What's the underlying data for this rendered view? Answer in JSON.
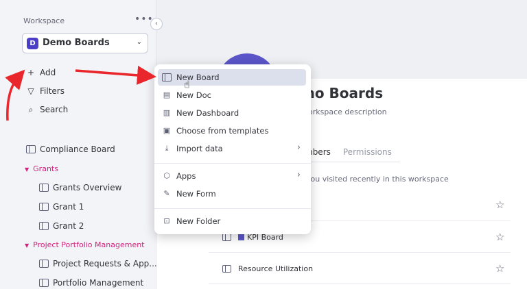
{
  "sidebar": {
    "header": "Workspace",
    "more": "•••",
    "workspace_badge": "D",
    "workspace_name": "Demo Boards",
    "actions": [
      {
        "label": "Add",
        "icon": "plus-icon"
      },
      {
        "label": "Filters",
        "icon": "filter-icon"
      },
      {
        "label": "Search",
        "icon": "search-icon"
      }
    ],
    "tree": {
      "compliance": "Compliance Board",
      "grants_folder": "Grants",
      "grants_items": [
        "Grants Overview",
        "Grant 1",
        "Grant 2"
      ],
      "ppm_folder": "Project Portfolio Management",
      "ppm_items": [
        "Project Requests & App...",
        "Portfolio Management"
      ]
    }
  },
  "menu": {
    "items": [
      {
        "label": "New Board",
        "icon": "board-icon",
        "active": true
      },
      {
        "label": "New Doc",
        "icon": "doc-icon"
      },
      {
        "label": "New Dashboard",
        "icon": "dashboard-icon"
      },
      {
        "label": "Choose from templates",
        "icon": "templates-icon"
      },
      {
        "label": "Import data",
        "icon": "import-icon",
        "submenu": true
      },
      {
        "label": "Apps",
        "icon": "apps-icon",
        "submenu": true
      },
      {
        "label": "New Form",
        "icon": "form-icon"
      },
      {
        "label": "New Folder",
        "icon": "folder-icon"
      }
    ]
  },
  "main": {
    "title": "mo Boards",
    "description": "workspace description",
    "tab_members": "mbers",
    "tab_permissions": "Permissions",
    "recent_hint": "you visited recently in this workspace",
    "rows": [
      "KPI Board",
      "Resource Utilization"
    ]
  },
  "colors": {
    "accent": "#5b56c9",
    "folder_pink": "#d1237e",
    "annotation_red": "#e8262b"
  }
}
